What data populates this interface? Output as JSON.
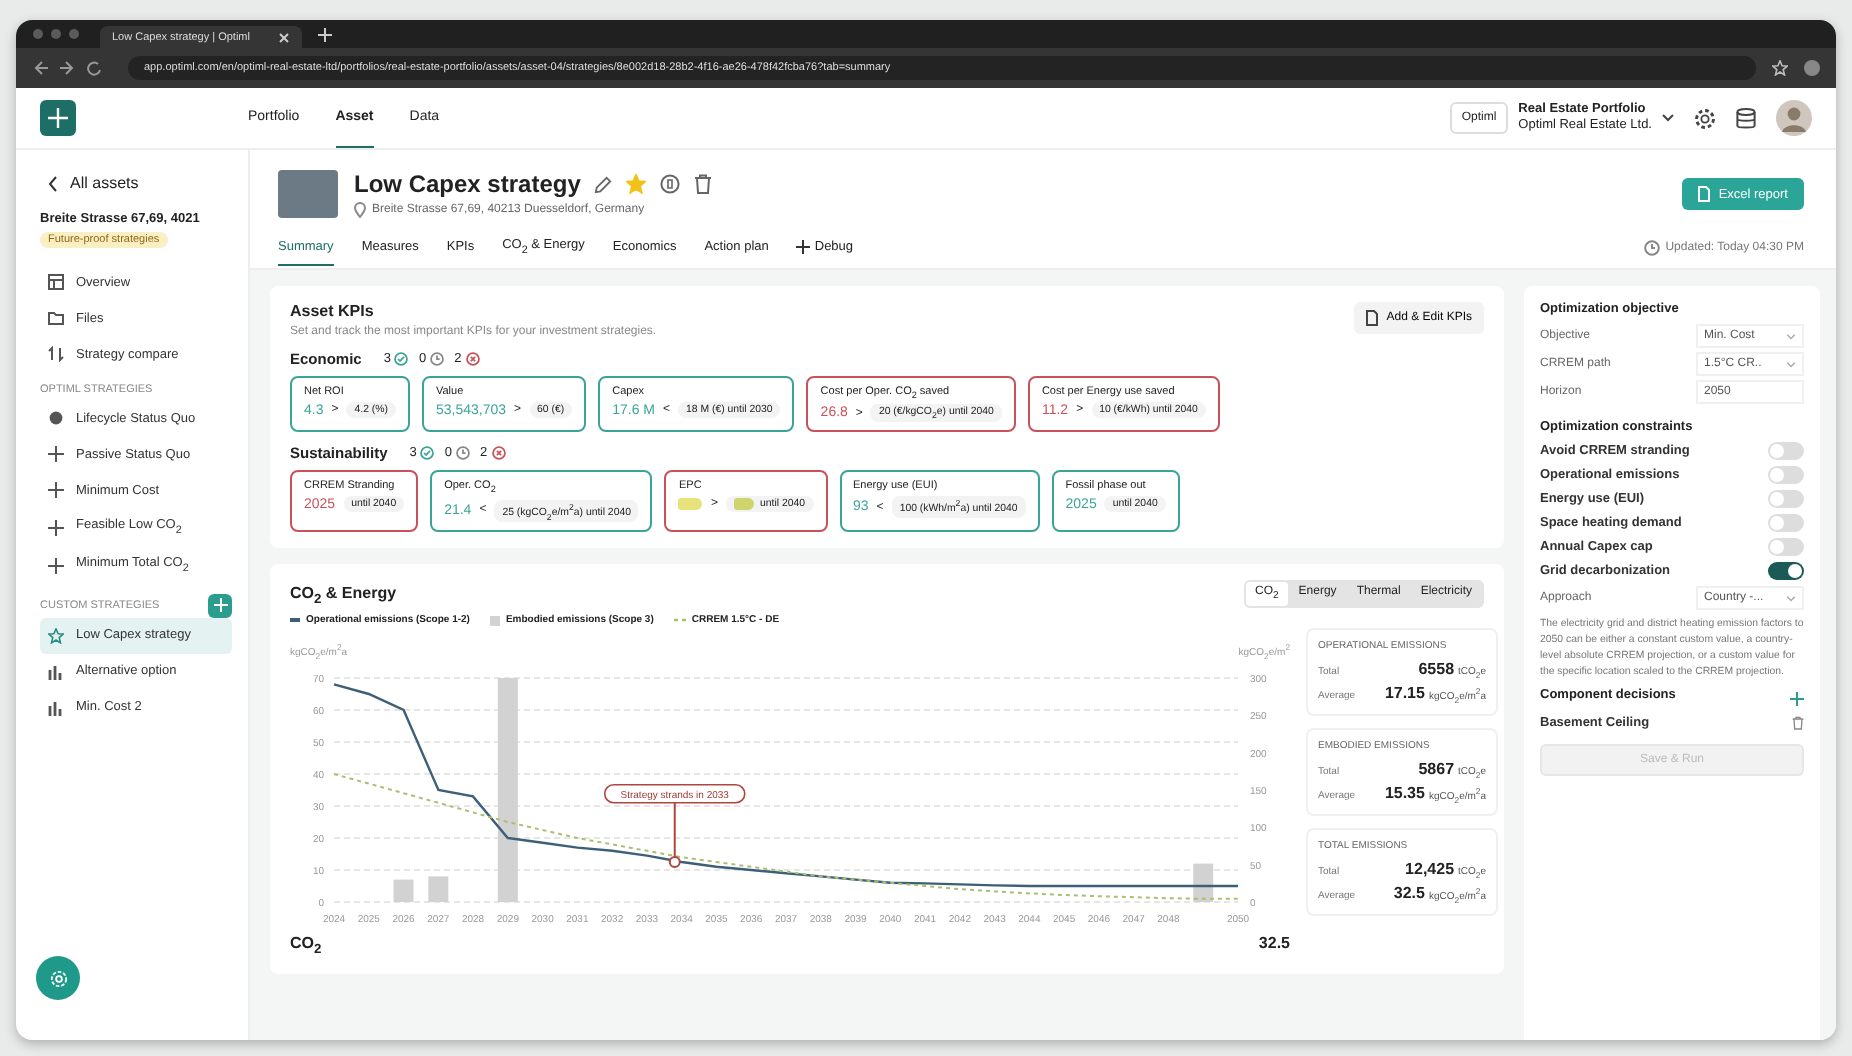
{
  "browser": {
    "tab_title": "Low Capex strategy | Optiml",
    "url": "app.optiml.com/en/optiml-real-estate-ltd/portfolios/real-estate-portfolio/assets/asset-04/strategies/8e002d18-28b2-4f16-ae26-478f42fcba76?tab=summary"
  },
  "nav": [
    {
      "label": "Portfolio",
      "selected": false
    },
    {
      "label": "Asset",
      "selected": true
    },
    {
      "label": "Data",
      "selected": false
    }
  ],
  "account": {
    "logo_text": "Optiml",
    "portfolio": "Real Estate Portfolio",
    "company": "Optiml Real Estate Ltd."
  },
  "sidebar": {
    "back": "All assets",
    "asset_name": "Breite Strasse 67,69, 4021",
    "badge": "Future-proof strategies",
    "items": [
      {
        "label": "Overview",
        "selected": false
      },
      {
        "label": "Files",
        "selected": false
      },
      {
        "label": "Strategy compare",
        "selected": false
      }
    ],
    "optiml_title": "OPTIML STRATEGIES",
    "optiml": [
      {
        "label": "Lifecycle Status Quo",
        "selected": false
      },
      {
        "label": "Passive Status Quo",
        "selected": false
      },
      {
        "label": "Minimum Cost",
        "selected": false
      },
      {
        "label": "Feasible Low CO$_{2}$",
        "selected": false
      },
      {
        "label": "Minimum Total CO$_{2}$",
        "selected": false
      }
    ],
    "custom_title": "CUSTOM STRATEGIES",
    "custom": [
      {
        "label": "Low Capex strategy",
        "selected": true
      },
      {
        "label": "Alternative option",
        "selected": false
      },
      {
        "label": "Min. Cost 2",
        "selected": false
      }
    ]
  },
  "asset": {
    "title": "Low Capex strategy",
    "starred": true,
    "address": "Breite Strasse 67,69, 40213 Duesseldorf, Germany",
    "excel_button": "Excel report",
    "updated": "Updated: Today 04:30 PM"
  },
  "tabs": [
    {
      "label": "Summary",
      "selected": true
    },
    {
      "label": "Measures",
      "selected": false
    },
    {
      "label": "KPIs",
      "selected": false
    },
    {
      "label": "CO$_{2}$ & Energy",
      "selected": false
    },
    {
      "label": "Economics",
      "selected": false
    },
    {
      "label": "Action plan",
      "selected": false
    },
    {
      "label": "Debug",
      "selected": false
    }
  ],
  "kpis": {
    "title": "Asset KPIs",
    "subtitle": "Set and track the most important KPIs for your investment strategies.",
    "edit_button": "Add & Edit KPIs",
    "groups": [
      {
        "title": "Economic",
        "met": "3",
        "pending": "0",
        "missed": "2",
        "items": [
          {
            "kind": "number",
            "title": "Net ROI",
            "value": "4.3",
            "comparator": ">",
            "target": "4.2 (%)",
            "met": true
          },
          {
            "kind": "number",
            "title": "Value",
            "value": "53,543,703",
            "comparator": ">",
            "target": "60 (€)",
            "met": true
          },
          {
            "kind": "number",
            "title": "Capex",
            "value": "17.6 M",
            "comparator": "<",
            "target": "18 M (€) until 2030",
            "met": true
          },
          {
            "kind": "number",
            "title": "Cost per Oper. CO$_{2}$ saved",
            "value": "26.8",
            "comparator": ">",
            "target": "20 (€/kgCO$_{2}$e) until 2040",
            "met": false
          },
          {
            "kind": "number",
            "title": "Cost per Energy use saved",
            "value": "11.2",
            "comparator": ">",
            "target": "10 (€/kWh) until 2040",
            "met": false
          }
        ]
      },
      {
        "title": "Sustainability",
        "met": "3",
        "pending": "0",
        "missed": "2",
        "items": [
          {
            "kind": "number",
            "title": "CRREM Stranding",
            "value": "2025",
            "target": "until 2040",
            "met": false
          },
          {
            "kind": "number",
            "title": "Oper. CO$_{2}$",
            "value": "21.4",
            "comparator": "<",
            "target": "25 (kgCO$_{2}$e/m$^{2}$a) until 2040",
            "met": true
          },
          {
            "kind": "swatch",
            "title": "EPC",
            "comparator": ">",
            "target": "until 2040",
            "met": false
          },
          {
            "kind": "number",
            "title": "Energy use (EUI)",
            "value": "93",
            "comparator": "<",
            "target": "100 (kWh/m$^{2}$a) until 2040",
            "met": true
          },
          {
            "kind": "number",
            "title": "Fossil phase out",
            "value": "2025",
            "target": "until 2040",
            "met": true
          }
        ]
      }
    ]
  },
  "co2": {
    "title": "CO$_{2}$ & Energy",
    "toggle": [
      {
        "label": "CO$_{2}$",
        "selected": true
      },
      {
        "label": "Energy",
        "selected": false
      },
      {
        "label": "Thermal",
        "selected": false
      },
      {
        "label": "Electricity",
        "selected": false
      }
    ],
    "left_unit": "kgCO$_{2}$e/m$^{2}$a",
    "right_unit": "kgCO$_{2}$e/m$^{2}$",
    "right_ticks": [
      "300",
      "250",
      "200",
      "150",
      "100",
      "50",
      "0"
    ],
    "chart_data": {
      "type": "line",
      "x": [
        2024,
        2025,
        2026,
        2027,
        2028,
        2029,
        2030,
        2031,
        2032,
        2033,
        2034,
        2035,
        2036,
        2037,
        2038,
        2039,
        2040,
        2041,
        2042,
        2043,
        2044,
        2045,
        2046,
        2047,
        2048,
        2049,
        2050
      ],
      "xlim": [
        2024,
        2050
      ],
      "ylim": [
        0,
        70
      ],
      "grid": true,
      "xticks": [
        2024,
        2025,
        2026,
        2027,
        2028,
        2029,
        2030,
        2031,
        2032,
        2033,
        2034,
        2035,
        2036,
        2037,
        2038,
        2039,
        2040,
        2041,
        2042,
        2043,
        2044,
        2045,
        2046,
        2047,
        2048,
        2050
      ],
      "yticks": [
        0,
        10,
        20,
        30,
        40,
        50,
        60,
        70
      ],
      "series": [
        {
          "name": "Operational emissions (Scope 1-2)",
          "type": "line",
          "line_style": "solid",
          "color": "#3d5f78",
          "values": [
            68,
            65,
            60,
            35,
            33,
            20,
            18.5,
            17,
            16,
            14.5,
            12.5,
            11,
            10,
            9,
            8,
            7,
            6,
            5.8,
            5.5,
            5.2,
            5,
            5,
            5,
            5,
            5,
            5,
            5
          ]
        },
        {
          "name": "Embodied emissions (Scope 3)",
          "type": "bar",
          "color": "#d2d2d2",
          "values": [
            null,
            null,
            7,
            8,
            null,
            70,
            null,
            null,
            null,
            null,
            null,
            null,
            null,
            null,
            null,
            null,
            null,
            null,
            null,
            null,
            null,
            null,
            null,
            null,
            null,
            12,
            null
          ]
        },
        {
          "name": "CRREM 1.5°C - DE",
          "type": "line",
          "line_style": "dashed",
          "color": "#a8c070",
          "values": [
            40,
            37,
            34,
            31,
            28,
            25,
            22.5,
            20,
            18,
            16,
            14,
            12.5,
            11,
            9.5,
            8,
            7,
            6,
            5,
            4,
            3.3,
            2.7,
            2.2,
            1.8,
            1.5,
            1.2,
            1,
            1
          ]
        }
      ],
      "annotations": [
        {
          "x": 2033.8,
          "y": 12.5,
          "text": "Strategy strands in 2033"
        }
      ]
    },
    "stats": [
      {
        "title": "OPERATIONAL EMISSIONS",
        "rows": [
          {
            "label": "Total",
            "value": "6558",
            "unit": "tCO$_{2}$e"
          },
          {
            "label": "Average",
            "value": "17.15",
            "unit": "kgCO$_{2}$e/m$^{2}$a"
          }
        ]
      },
      {
        "title": "EMBODIED EMISSIONS",
        "rows": [
          {
            "label": "Total",
            "value": "5867",
            "unit": "tCO$_{2}$e"
          },
          {
            "label": "Average",
            "value": "15.35",
            "unit": "kgCO$_{2}$e/m$^{2}$a"
          }
        ]
      },
      {
        "title": "TOTAL EMISSIONS",
        "rows": [
          {
            "label": "Total",
            "value": "12,425",
            "unit": "tCO$_{2}$e"
          },
          {
            "label": "Average",
            "value": "32.5",
            "unit": "kgCO$_{2}$e/m$^{2}$a"
          }
        ]
      }
    ],
    "summary": {
      "title": "CO$_{2}$",
      "value": "32.5"
    }
  },
  "optimization": {
    "title": "Optimization objective",
    "fields": [
      {
        "label": "Objective",
        "value": "Min. Cost",
        "kind": "select"
      },
      {
        "label": "CRREM path",
        "value": "1.5°C CR..",
        "kind": "select"
      },
      {
        "label": "Horizon",
        "value": "2050",
        "kind": "input"
      }
    ],
    "constraints_title": "Optimization constraints",
    "constraints": [
      {
        "label": "Avoid CRREM stranding",
        "on": false
      },
      {
        "label": "Operational emissions",
        "on": false
      },
      {
        "label": "Energy use (EUI)",
        "on": false
      },
      {
        "label": "Space heating demand",
        "on": false
      },
      {
        "label": "Annual Capex cap",
        "on": false
      },
      {
        "label": "Grid decarbonization",
        "on": true
      }
    ],
    "approach": {
      "label": "Approach",
      "value": "Country -..."
    },
    "note": "The electricity grid and district heating emission factors to 2050 can be either a constant custom value, a country-level absolute CRREM projection, or a custom value for the specific location scaled to the CRREM projection.",
    "components_title": "Component decisions",
    "components": [
      {
        "label": "Basement Ceiling"
      }
    ],
    "run_button": {
      "label": "Save & Run",
      "disabled": true
    }
  }
}
